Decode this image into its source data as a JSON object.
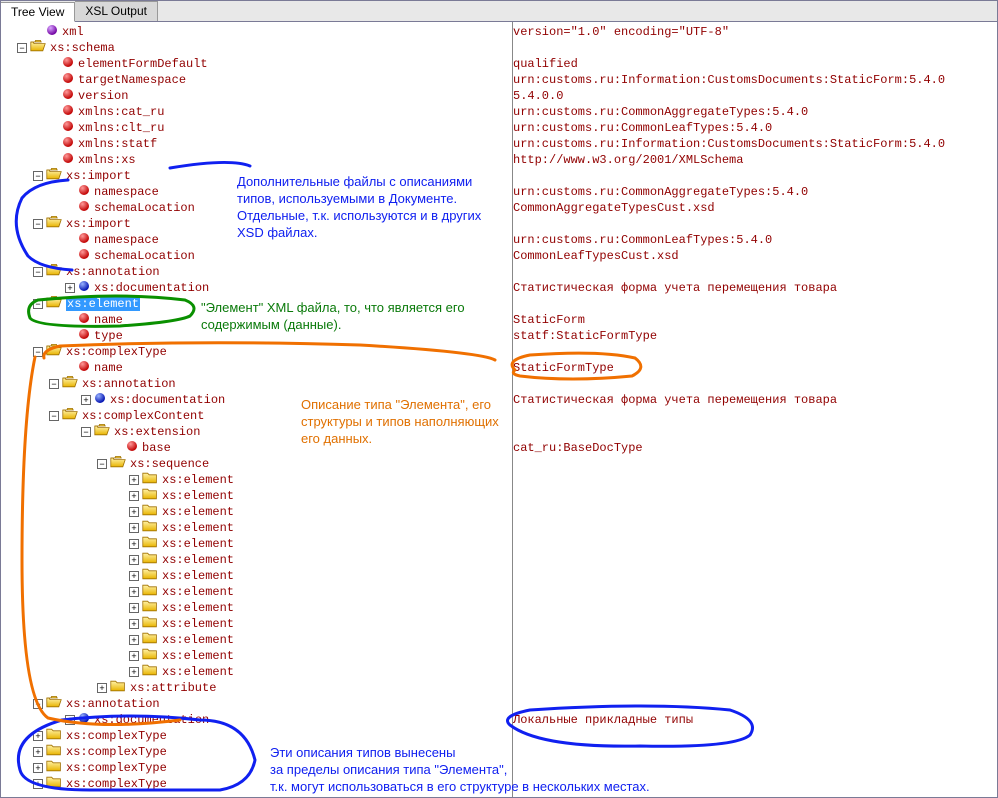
{
  "tabs": {
    "tree": "Tree View",
    "xsl": "XSL Output"
  },
  "annotations": {
    "import": "Дополнительные файлы с описаниями типов, используемыми в Документе. Отдельные, т.к. используются и в других XSD файлах.",
    "element": "\"Элемент\"  XML файла, то, что является его содержимым (данные).",
    "type": "Описание типа \"Элемента\", его структуры и типов наполняющих его данных.",
    "local1": "Эти описания типов вынесены",
    "local2": "за пределы описания типа \"Элемента\",",
    "local3": "т.к. могут использоваться в его структуре в нескольких местах."
  },
  "rows": [
    {
      "d": 2,
      "t": null,
      "icon": "bp",
      "label": "xml",
      "val": "version=\"1.0\" encoding=\"UTF-8\""
    },
    {
      "d": 1,
      "t": "-",
      "icon": "fo",
      "label": "xs:schema",
      "val": ""
    },
    {
      "d": 3,
      "t": null,
      "icon": "br",
      "label": "elementFormDefault",
      "val": "qualified"
    },
    {
      "d": 3,
      "t": null,
      "icon": "br",
      "label": "targetNamespace",
      "val": "urn:customs.ru:Information:CustomsDocuments:StaticForm:5.4.0"
    },
    {
      "d": 3,
      "t": null,
      "icon": "br",
      "label": "version",
      "val": "5.4.0.0"
    },
    {
      "d": 3,
      "t": null,
      "icon": "br",
      "label": "xmlns:cat_ru",
      "val": "urn:customs.ru:CommonAggregateTypes:5.4.0"
    },
    {
      "d": 3,
      "t": null,
      "icon": "br",
      "label": "xmlns:clt_ru",
      "val": "urn:customs.ru:CommonLeafTypes:5.4.0"
    },
    {
      "d": 3,
      "t": null,
      "icon": "br",
      "label": "xmlns:statf",
      "val": "urn:customs.ru:Information:CustomsDocuments:StaticForm:5.4.0"
    },
    {
      "d": 3,
      "t": null,
      "icon": "br",
      "label": "xmlns:xs",
      "val": "http://www.w3.org/2001/XMLSchema"
    },
    {
      "d": 2,
      "t": "-",
      "icon": "fo",
      "label": "xs:import",
      "val": ""
    },
    {
      "d": 4,
      "t": null,
      "icon": "br",
      "label": "namespace",
      "val": "urn:customs.ru:CommonAggregateTypes:5.4.0"
    },
    {
      "d": 4,
      "t": null,
      "icon": "br",
      "label": "schemaLocation",
      "val": "CommonAggregateTypesCust.xsd"
    },
    {
      "d": 2,
      "t": "-",
      "icon": "fo",
      "label": "xs:import",
      "val": ""
    },
    {
      "d": 4,
      "t": null,
      "icon": "br",
      "label": "namespace",
      "val": "urn:customs.ru:CommonLeafTypes:5.4.0"
    },
    {
      "d": 4,
      "t": null,
      "icon": "br",
      "label": "schemaLocation",
      "val": "CommonLeafTypesCust.xsd"
    },
    {
      "d": 2,
      "t": "-",
      "icon": "fo",
      "label": "xs:annotation",
      "val": ""
    },
    {
      "d": 4,
      "t": "+",
      "icon": "bb",
      "label": "xs:documentation",
      "val": "Статистическая форма учета перемещения товара"
    },
    {
      "d": 2,
      "t": "-",
      "icon": "fo",
      "label": "xs:element",
      "val": "",
      "sel": true
    },
    {
      "d": 4,
      "t": null,
      "icon": "br",
      "label": "name",
      "val": "StaticForm"
    },
    {
      "d": 4,
      "t": null,
      "icon": "br",
      "label": "type",
      "val": "statf:StaticFormType"
    },
    {
      "d": 2,
      "t": "-",
      "icon": "fo",
      "label": "xs:complexType",
      "val": ""
    },
    {
      "d": 4,
      "t": null,
      "icon": "br",
      "label": "name",
      "val": "StaticFormType"
    },
    {
      "d": 3,
      "t": "-",
      "icon": "fo",
      "label": "xs:annotation",
      "val": ""
    },
    {
      "d": 5,
      "t": "+",
      "icon": "bb",
      "label": "xs:documentation",
      "val": "Статистическая форма учета перемещения товара"
    },
    {
      "d": 3,
      "t": "-",
      "icon": "fo",
      "label": "xs:complexContent",
      "val": ""
    },
    {
      "d": 5,
      "t": "-",
      "icon": "fo",
      "label": "xs:extension",
      "val": ""
    },
    {
      "d": 7,
      "t": null,
      "icon": "br",
      "label": "base",
      "val": "cat_ru:BaseDocType"
    },
    {
      "d": 6,
      "t": "-",
      "icon": "fo",
      "label": "xs:sequence",
      "val": ""
    },
    {
      "d": 8,
      "t": "+",
      "icon": "fc",
      "label": "xs:element",
      "val": ""
    },
    {
      "d": 8,
      "t": "+",
      "icon": "fc",
      "label": "xs:element",
      "val": ""
    },
    {
      "d": 8,
      "t": "+",
      "icon": "fc",
      "label": "xs:element",
      "val": ""
    },
    {
      "d": 8,
      "t": "+",
      "icon": "fc",
      "label": "xs:element",
      "val": ""
    },
    {
      "d": 8,
      "t": "+",
      "icon": "fc",
      "label": "xs:element",
      "val": ""
    },
    {
      "d": 8,
      "t": "+",
      "icon": "fc",
      "label": "xs:element",
      "val": ""
    },
    {
      "d": 8,
      "t": "+",
      "icon": "fc",
      "label": "xs:element",
      "val": ""
    },
    {
      "d": 8,
      "t": "+",
      "icon": "fc",
      "label": "xs:element",
      "val": ""
    },
    {
      "d": 8,
      "t": "+",
      "icon": "fc",
      "label": "xs:element",
      "val": ""
    },
    {
      "d": 8,
      "t": "+",
      "icon": "fc",
      "label": "xs:element",
      "val": ""
    },
    {
      "d": 8,
      "t": "+",
      "icon": "fc",
      "label": "xs:element",
      "val": ""
    },
    {
      "d": 8,
      "t": "+",
      "icon": "fc",
      "label": "xs:element",
      "val": ""
    },
    {
      "d": 8,
      "t": "+",
      "icon": "fc",
      "label": "xs:element",
      "val": ""
    },
    {
      "d": 6,
      "t": "+",
      "icon": "fc",
      "label": "xs:attribute",
      "val": ""
    },
    {
      "d": 2,
      "t": "-",
      "icon": "fo",
      "label": "xs:annotation",
      "val": ""
    },
    {
      "d": 4,
      "t": "+",
      "icon": "bb",
      "label": "xs:documentation",
      "val": "Локальные прикладные типы"
    },
    {
      "d": 2,
      "t": "+",
      "icon": "fc",
      "label": "xs:complexType",
      "val": ""
    },
    {
      "d": 2,
      "t": "+",
      "icon": "fc",
      "label": "xs:complexType",
      "val": ""
    },
    {
      "d": 2,
      "t": "+",
      "icon": "fc",
      "label": "xs:complexType",
      "val": ""
    },
    {
      "d": 2,
      "t": "+",
      "icon": "fc",
      "label": "xs:complexType",
      "val": ""
    }
  ]
}
